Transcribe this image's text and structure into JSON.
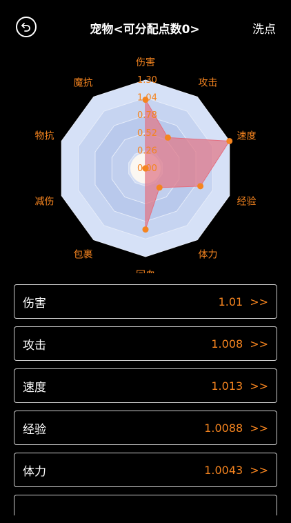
{
  "header": {
    "title": "宠物<可分配点数0>",
    "reset_label": "洗点"
  },
  "chart_data": {
    "type": "radar",
    "axes": [
      "伤害",
      "攻击",
      "速度",
      "经验",
      "体力",
      "回血",
      "包裹",
      "减伤",
      "物抗",
      "魔抗"
    ],
    "ticks": [
      "0.00",
      "0.26",
      "0.52",
      "0.78",
      "1.04",
      "1.30"
    ],
    "range": [
      0,
      1.3
    ],
    "values": [
      1.01,
      0.56,
      1.3,
      0.85,
      0.35,
      0.9,
      0,
      0,
      0,
      0
    ],
    "colors": {
      "grid": "#c9d6f1",
      "fill": "#e07a8a",
      "point": "#f5841f",
      "label": "#f5841f"
    }
  },
  "stats": [
    {
      "name": "伤害",
      "value": "1.01",
      "arrow": ">>"
    },
    {
      "name": "攻击",
      "value": "1.008",
      "arrow": ">>"
    },
    {
      "name": "速度",
      "value": "1.013",
      "arrow": ">>"
    },
    {
      "name": "经验",
      "value": "1.0088",
      "arrow": ">>"
    },
    {
      "name": "体力",
      "value": "1.0043",
      "arrow": ">>"
    }
  ]
}
